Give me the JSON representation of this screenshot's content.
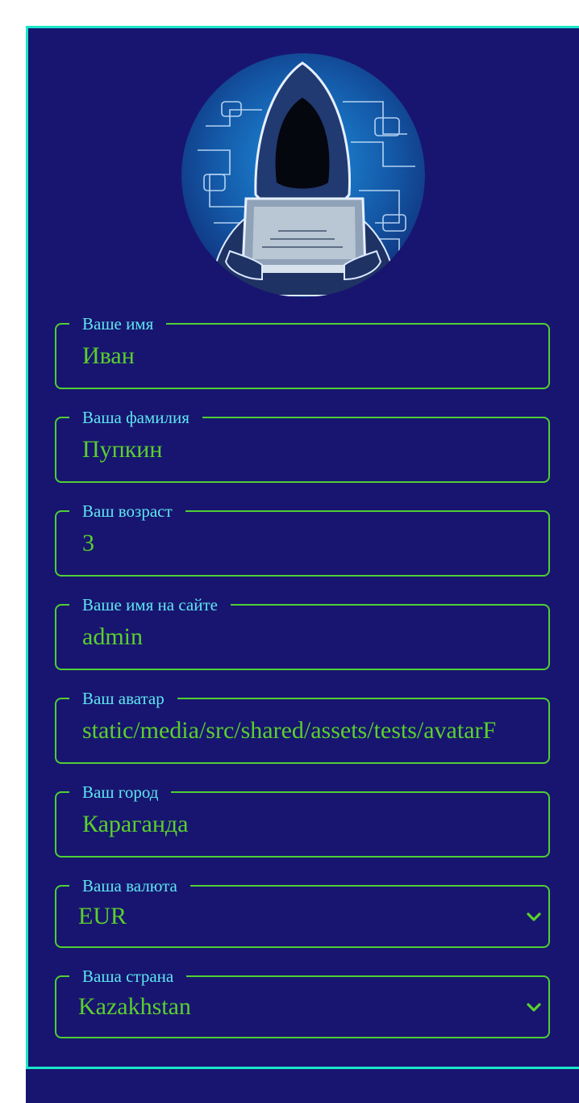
{
  "profile": {
    "fields": [
      {
        "label": "Ваше имя",
        "value": "Иван"
      },
      {
        "label": "Ваша фамилия",
        "value": "Пупкин"
      },
      {
        "label": "Ваш возраст",
        "value": "3"
      },
      {
        "label": "Ваше имя на сайте",
        "value": "admin"
      },
      {
        "label": "Ваш аватар",
        "value": "static/media/src/shared/assets/tests/avatarF"
      },
      {
        "label": "Ваш город",
        "value": "Караганда"
      }
    ],
    "selects": [
      {
        "label": "Ваша валюта",
        "value": "EUR"
      },
      {
        "label": "Ваша страна",
        "value": "Kazakhstan"
      }
    ]
  },
  "colors": {
    "panel_bg": "#181570",
    "card_border": "#19e6c8",
    "field_border": "#4fcf34",
    "label": "#5ee6f0",
    "value": "#5ad02c"
  },
  "icons": {
    "avatar": "hooded-hacker-laptop-avatar",
    "select_arrow": "chevron-down-icon"
  }
}
